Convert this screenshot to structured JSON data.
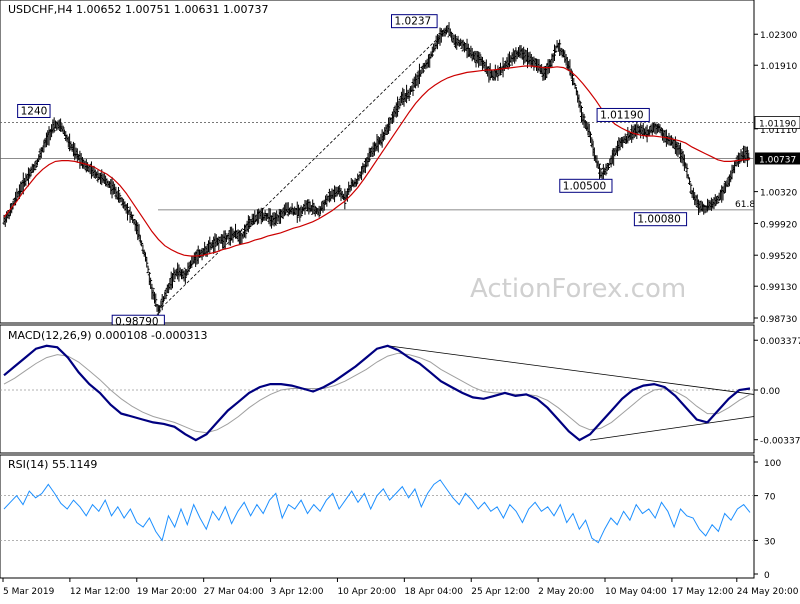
{
  "chart_data": [
    {
      "type": "candlestick",
      "title": "USDCHF,H4  1.00652 1.00751 1.00631 1.00737",
      "ylim": [
        0.9873,
        1.0263
      ],
      "yticks": [
        "1.02300",
        "1.01910",
        "1.01110",
        "1.00320",
        "0.99920",
        "0.99520",
        "0.99130",
        "0.98730"
      ],
      "current_price": "1.00737",
      "level_label": "1.01190",
      "levels": [
        {
          "label": "1.01190",
          "value": 1.0119,
          "style": "dotted"
        },
        {
          "label": "",
          "value": 1.00737,
          "style": "solid"
        },
        {
          "label": "61.8",
          "value": 1.0009,
          "style": "solid"
        }
      ],
      "fib_label": "61.8",
      "annotations": [
        {
          "text": "1.0237",
          "x": 0.55,
          "y": 1.0237
        },
        {
          "text": "1240",
          "x": 0.04,
          "y": 1.0124
        },
        {
          "text": "1.01190",
          "x": 0.83,
          "y": 1.0119
        },
        {
          "text": "1.00500",
          "x": 0.78,
          "y": 1.005
        },
        {
          "text": "1.00080",
          "x": 0.88,
          "y": 1.0008
        },
        {
          "text": "0.98790",
          "x": 0.18,
          "y": 0.9879
        }
      ],
      "price": [
        0.9995,
        1.0007,
        1.0026,
        1.0042,
        1.0055,
        1.0067,
        1.0085,
        1.0104,
        1.0116,
        1.0113,
        1.0095,
        1.0081,
        1.0072,
        1.0062,
        1.0056,
        1.005,
        1.0044,
        1.0036,
        1.0024,
        1.0012,
        0.9998,
        0.9978,
        0.995,
        0.9908,
        0.9882,
        0.99,
        0.992,
        0.9932,
        0.9926,
        0.994,
        0.9952,
        0.9956,
        0.9963,
        0.9968,
        0.9972,
        0.9976,
        0.9979,
        0.9975,
        0.999,
        0.9998,
        1.0003,
        1.0001,
        0.9994,
        1.0002,
        1.001,
        1.0008,
        1.0006,
        1.0015,
        1.001,
        1.0006,
        1.002,
        1.0028,
        1.0032,
        1.0024,
        1.004,
        1.0046,
        1.0062,
        1.008,
        1.0092,
        1.0102,
        1.0118,
        1.0136,
        1.015,
        1.0155,
        1.017,
        1.0185,
        1.0196,
        1.0215,
        1.023,
        1.0237,
        1.0222,
        1.0218,
        1.0212,
        1.0202,
        1.0198,
        1.0188,
        1.0177,
        1.0182,
        1.0192,
        1.02,
        1.0207,
        1.0204,
        1.0198,
        1.019,
        1.018,
        1.0193,
        1.0216,
        1.0205,
        1.0185,
        1.016,
        1.0125,
        1.0108,
        1.0072,
        1.0052,
        1.0065,
        1.0082,
        1.0095,
        1.01,
        1.0108,
        1.011,
        1.0106,
        1.0113,
        1.0112,
        1.0098,
        1.0094,
        1.0085,
        1.0064,
        1.003,
        1.0015,
        1.001,
        1.0016,
        1.0022,
        1.0036,
        1.005,
        1.0072,
        1.008,
        1.0074
      ],
      "moving_average": [
        1.0,
        1.001,
        1.002,
        1.0032,
        1.0042,
        1.0052,
        1.006,
        1.0066,
        1.007,
        1.0071,
        1.0071,
        1.007,
        1.0068,
        1.0066,
        1.0063,
        1.0058,
        1.0054,
        1.0048,
        1.004,
        1.003,
        1.0018,
        1.0006,
        0.9994,
        0.9982,
        0.9972,
        0.9964,
        0.9959,
        0.9955,
        0.9952,
        0.9951,
        0.9951,
        0.9952,
        0.9954,
        0.9956,
        0.9959,
        0.9961,
        0.9964,
        0.9966,
        0.9968,
        0.9971,
        0.9973,
        0.9976,
        0.9978,
        0.998,
        0.9983,
        0.9986,
        0.9988,
        0.9991,
        0.9994,
        0.9998,
        1.0003,
        1.0008,
        1.0014,
        1.002,
        1.0028,
        1.0037,
        1.0048,
        1.006,
        1.0072,
        1.0084,
        1.0096,
        1.0108,
        1.012,
        1.0132,
        1.0143,
        1.0152,
        1.016,
        1.0166,
        1.0171,
        1.0175,
        1.0178,
        1.018,
        1.0182,
        1.0183,
        1.0184,
        1.0185,
        1.0185,
        1.0186,
        1.0187,
        1.0188,
        1.0189,
        1.019,
        1.019,
        1.0189,
        1.0188,
        1.0188,
        1.0189,
        1.0188,
        1.0184,
        1.0177,
        1.0168,
        1.0158,
        1.0147,
        1.0135,
        1.0125,
        1.0117,
        1.0112,
        1.0108,
        1.0105,
        1.0103,
        1.0102,
        1.0102,
        1.0101,
        1.01,
        1.0098,
        1.0096,
        1.0093,
        1.0088,
        1.0084,
        1.008,
        1.0076,
        1.0072,
        1.007,
        1.007,
        1.0071,
        1.0072,
        1.0073
      ]
    },
    {
      "type": "line",
      "title": "MACD(12,26,9) 0.000108 -0.000313",
      "ylim": [
        -0.0038,
        0.0038
      ],
      "yticks": [
        "0.003377",
        "0.00",
        "-0.003373"
      ],
      "current_label": "0.00",
      "macd": [
        0.001,
        0.0016,
        0.0022,
        0.0028,
        0.003,
        0.0029,
        0.0022,
        0.0012,
        0.0004,
        -0.0002,
        -0.001,
        -0.0016,
        -0.0018,
        -0.002,
        -0.0022,
        -0.0023,
        -0.0025,
        -0.003,
        -0.0034,
        -0.003,
        -0.0022,
        -0.0014,
        -0.0008,
        -0.0002,
        0.0002,
        0.0004,
        0.0004,
        0.0003,
        0.0001,
        -0.0001,
        0.0002,
        0.0006,
        0.0011,
        0.0016,
        0.0022,
        0.0028,
        0.003,
        0.0027,
        0.0022,
        0.0018,
        0.0012,
        0.0006,
        0.0002,
        -0.0002,
        -0.0005,
        -0.0006,
        -0.0004,
        -0.0002,
        -0.0004,
        -0.0003,
        -0.0006,
        -0.0012,
        -0.002,
        -0.0028,
        -0.0034,
        -0.003,
        -0.0022,
        -0.0014,
        -0.0006,
        0.0,
        0.0003,
        0.0004,
        0.0002,
        -0.0004,
        -0.0012,
        -0.002,
        -0.0022,
        -0.0014,
        -0.0006,
        0.0,
        0.0001
      ],
      "signal": [
        0.0004,
        0.0008,
        0.0013,
        0.0018,
        0.0022,
        0.0024,
        0.0023,
        0.0019,
        0.0013,
        0.0007,
        0.0,
        -0.0006,
        -0.0011,
        -0.0015,
        -0.0018,
        -0.002,
        -0.0022,
        -0.0025,
        -0.0028,
        -0.0029,
        -0.0027,
        -0.0023,
        -0.0018,
        -0.0012,
        -0.0007,
        -0.0003,
        0.0,
        0.0001,
        0.0001,
        0.0001,
        0.0001,
        0.0003,
        0.0006,
        0.001,
        0.0014,
        0.0019,
        0.0023,
        0.0025,
        0.0024,
        0.0022,
        0.0019,
        0.0014,
        0.001,
        0.0006,
        0.0002,
        -0.0001,
        -0.0002,
        -0.0002,
        -0.0003,
        -0.0003,
        -0.0004,
        -0.0007,
        -0.0012,
        -0.0018,
        -0.0024,
        -0.0027,
        -0.0026,
        -0.0022,
        -0.0016,
        -0.001,
        -0.0004,
        0.0,
        0.0001,
        -0.0001,
        -0.0005,
        -0.0011,
        -0.0016,
        -0.0016,
        -0.0012,
        -0.0007,
        -0.0003
      ]
    },
    {
      "type": "line",
      "title": "RSI(14) 55.1149",
      "ylim": [
        0,
        100
      ],
      "yticks": [
        "100",
        "70",
        "30",
        "0"
      ],
      "levels": [
        70,
        30
      ],
      "values": [
        58,
        64,
        70,
        62,
        74,
        68,
        72,
        80,
        72,
        63,
        58,
        66,
        60,
        52,
        62,
        56,
        66,
        52,
        60,
        50,
        58,
        46,
        42,
        50,
        38,
        30,
        52,
        42,
        58,
        44,
        62,
        50,
        40,
        56,
        48,
        60,
        45,
        56,
        64,
        52,
        62,
        54,
        66,
        72,
        50,
        62,
        58,
        66,
        54,
        62,
        56,
        66,
        72,
        58,
        66,
        74,
        64,
        72,
        58,
        70,
        76,
        66,
        72,
        78,
        68,
        76,
        60,
        72,
        80,
        84,
        76,
        68,
        62,
        72,
        66,
        58,
        64,
        56,
        60,
        50,
        62,
        56,
        46,
        58,
        64,
        56,
        60,
        52,
        62,
        46,
        54,
        40,
        48,
        32,
        28,
        40,
        50,
        44,
        56,
        48,
        62,
        54,
        58,
        50,
        64,
        56,
        42,
        58,
        52,
        50,
        40,
        34,
        44,
        38,
        54,
        48,
        58,
        62,
        55
      ]
    }
  ],
  "x_labels": [
    "5 Mar 2019",
    "12 Mar 12:00",
    "19 Mar 20:00",
    "27 Mar 04:00",
    "3 Apr 12:00",
    "10 Apr 20:00",
    "18 Apr 04:00",
    "25 Apr 12:00",
    "2 May 20:00",
    "10 May 04:00",
    "17 May 12:00",
    "24 May 20:00"
  ],
  "watermark": "ActionForex.com",
  "colors": {
    "bars": "#000000",
    "moving_average": "#cc0000",
    "macd": "#000080",
    "signal": "#a0a0a0",
    "rsi": "#1e90ff",
    "label_border": "#000080",
    "current_bg": "#000000",
    "current_fg": "#ffffff"
  }
}
